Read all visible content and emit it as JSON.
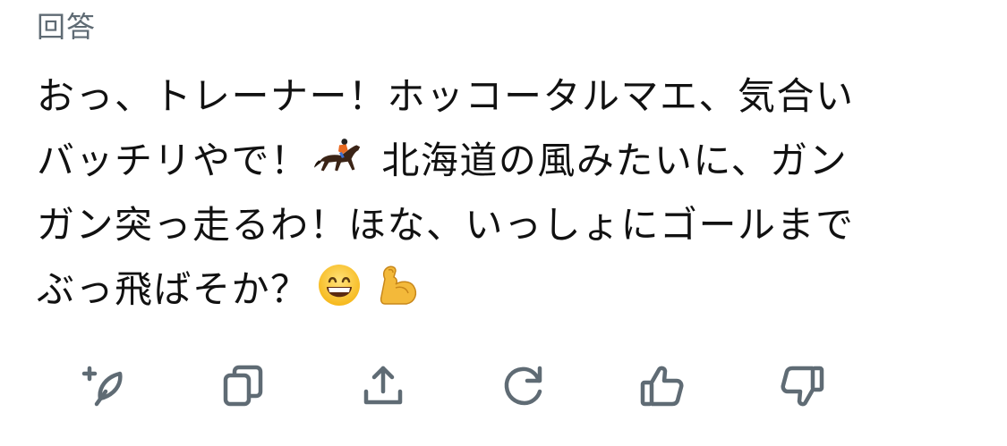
{
  "header": {
    "label": "回答"
  },
  "answer": {
    "lines": [
      "おっ、トレーナー！ホッコータルマエ、気合い",
      "バッチリやで！",
      "北海道の風みたいに、ガン",
      "ガン突っ走るわ！ほな、いっしょにゴールまで",
      "ぶっ飛ばそか？"
    ],
    "emojis": [
      "horse-racing-emoji",
      "grinning-face-emoji",
      "flexed-biceps-emoji"
    ]
  },
  "toolbar": {
    "icons": [
      "regenerate-with-feather-icon",
      "copy-icon",
      "share-icon",
      "refresh-icon",
      "thumbs-up-icon",
      "thumbs-down-icon"
    ]
  },
  "colors": {
    "icon": "#5f6b74",
    "text": "#111111",
    "header": "#5f6b74"
  }
}
